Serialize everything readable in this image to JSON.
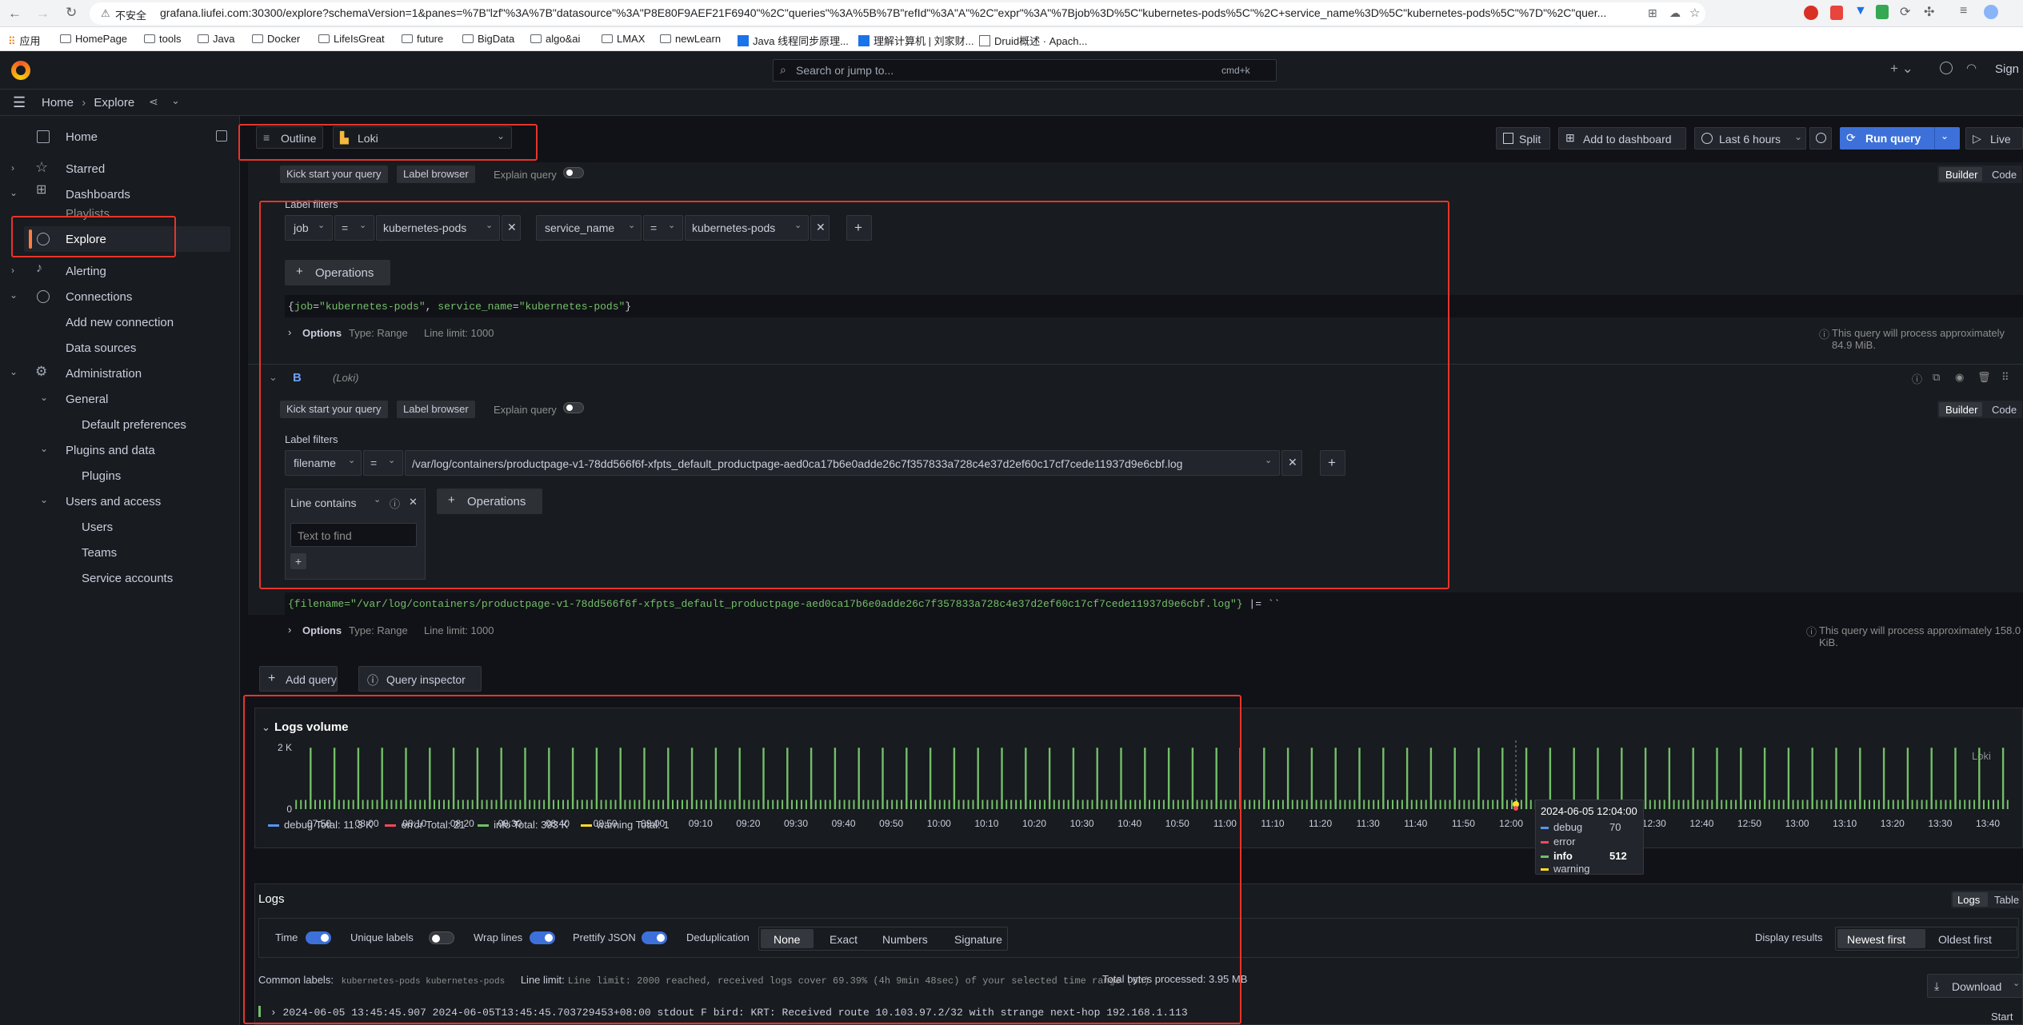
{
  "browser": {
    "insecure": "不安全",
    "url": "grafana.liufei.com:30300/explore?schemaVersion=1&panes=%7B\"lzf\"%3A%7B\"datasource\"%3A\"P8E80F9AEF21F6940\"%2C\"queries\"%3A%5B%7B\"refId\"%3A\"A\"%2C\"expr\"%3A\"%7Bjob%3D%5C\"kubernetes-pods%5C\"%2C+service_name%3D%5C\"kubernetes-pods%5C\"%7D\"%2C\"quer...",
    "bookmarks": [
      "应用",
      "HomePage",
      "tools",
      "Java",
      "Docker",
      "LifeIsGreat",
      "future",
      "BigData",
      "algo&ai",
      "LMAX",
      "newLearn",
      "Java 线程同步原理...",
      "理解计算机 | 刘家财...",
      "Druid概述 · Apach..."
    ]
  },
  "topbar": {
    "search_placeholder": "Search or jump to...",
    "shortcut": "cmd+k",
    "sign_in": "Sign"
  },
  "breadcrumb": {
    "home": "Home",
    "separator": "›",
    "current": "Explore"
  },
  "sidebar": {
    "home": "Home",
    "starred": "Starred",
    "dashboards": "Dashboards",
    "playlists": "Playlists",
    "explore": "Explore",
    "alerting": "Alerting",
    "connections": "Connections",
    "add_new_connection": "Add new connection",
    "data_sources": "Data sources",
    "administration": "Administration",
    "general": "General",
    "default_preferences": "Default preferences",
    "plugins_and_data": "Plugins and data",
    "plugins": "Plugins",
    "users_and_access": "Users and access",
    "users": "Users",
    "teams": "Teams",
    "service_accounts": "Service accounts"
  },
  "toolbar": {
    "outline": "Outline",
    "datasource": "Loki",
    "split": "Split",
    "add_to_dashboard": "Add to dashboard",
    "time_range": "Last 6 hours",
    "run_query": "Run query",
    "live": "Live"
  },
  "queryA": {
    "kick_start": "Kick start your query",
    "label_browser": "Label browser",
    "explain_query": "Explain query",
    "builder": "Builder",
    "code": "Code",
    "label_filters": "Label filters",
    "f1_label": "job",
    "f1_op": "=",
    "f1_value": "kubernetes-pods",
    "f2_label": "service_name",
    "f2_op": "=",
    "f2_value": "kubernetes-pods",
    "operations": "Operations",
    "expr_open": "{",
    "expr_k1": "job",
    "expr_eq": "=",
    "expr_v1": "\"kubernetes-pods\"",
    "expr_comma": ", ",
    "expr_k2": "service_name",
    "expr_v2": "\"kubernetes-pods\"",
    "expr_close": "}",
    "options": "Options",
    "type": "Type: Range",
    "line_limit": "Line limit: 1000",
    "process_note": "This query will process approximately 84.9 MiB."
  },
  "queryB": {
    "ref": "B",
    "datasource": "(Loki)",
    "kick_start": "Kick start your query",
    "label_browser": "Label browser",
    "explain_query": "Explain query",
    "builder": "Builder",
    "code": "Code",
    "label_filters": "Label filters",
    "f1_label": "filename",
    "f1_op": "=",
    "f1_value": "/var/log/containers/productpage-v1-78dd566f6f-xfpts_default_productpage-aed0ca17b6e0adde26c7f357833a728c4e37d2ef60c17cf7cede11937d9e6cbf.log",
    "line_contains": "Line contains",
    "text_placeholder": "Text to find",
    "operations": "Operations",
    "expr_main": "{filename=\"/var/log/containers/productpage-v1-78dd566f6f-xfpts_default_productpage-aed0ca17b6e0adde26c7f357833a728c4e37d2ef60c17cf7cede11937d9e6cbf.log\"}",
    "expr_tail": " |= ``",
    "options": "Options",
    "type": "Type: Range",
    "line_limit": "Line limit: 1000",
    "process_note": "This query will process approximately 158.0 KiB."
  },
  "actions": {
    "add_query": "Add query",
    "query_inspector": "Query inspector"
  },
  "logs_volume": {
    "title": "Logs volume",
    "source": "Loki",
    "y_ticks": [
      "2 K",
      "0"
    ],
    "x_ticks": [
      "07:50",
      "08:00",
      "08:10",
      "08:20",
      "08:30",
      "08:40",
      "08:50",
      "09:00",
      "09:10",
      "09:20",
      "09:30",
      "09:40",
      "09:50",
      "10:00",
      "10:10",
      "10:20",
      "10:30",
      "10:40",
      "10:50",
      "11:00",
      "11:10",
      "11:20",
      "11:30",
      "11:40",
      "11:50",
      "12:00",
      "12:10",
      "12:20",
      "12:30",
      "12:40",
      "12:50",
      "13:00",
      "13:10",
      "13:20",
      "13:30",
      "13:40"
    ],
    "legend": [
      {
        "name": "debug",
        "total": "Total: 11.3 K",
        "color": "#5794f2"
      },
      {
        "name": "error",
        "total": "Total: 21",
        "color": "#f2495c"
      },
      {
        "name": "info",
        "total": "Total: 393 K",
        "color": "#73bf69"
      },
      {
        "name": "warning",
        "total": "Total: 1",
        "color": "#fade2a"
      }
    ],
    "tooltip": {
      "time": "2024-06-05 12:04:00",
      "debug": "70",
      "error": "",
      "info": "512",
      "warning": ""
    }
  },
  "chart_data": {
    "type": "bar",
    "title": "Logs volume",
    "xlabel": "",
    "ylabel": "",
    "x_range": [
      "07:45",
      "13:45"
    ],
    "y_ticks": [
      0,
      2000
    ],
    "spike_interval_min": 5,
    "series": [
      {
        "name": "info",
        "spike_value": 2000,
        "baseline_value": 300,
        "total": 393000
      },
      {
        "name": "debug",
        "total": 11300
      },
      {
        "name": "error",
        "total": 21
      },
      {
        "name": "warning",
        "total": 1
      }
    ]
  },
  "logs": {
    "title": "Logs",
    "view_logs": "Logs",
    "view_table": "Table",
    "time": "Time",
    "unique_labels": "Unique labels",
    "wrap_lines": "Wrap lines",
    "prettify_json": "Prettify JSON",
    "deduplication": "Deduplication",
    "dedup_options": [
      "None",
      "Exact",
      "Numbers",
      "Signature"
    ],
    "display_results": "Display results",
    "newest_first": "Newest first",
    "oldest_first": "Oldest first",
    "common_labels": "Common labels:",
    "common_label_values": "kubernetes-pods kubernetes-pods",
    "line_limit_note": "Line limit: 2000 reached, received logs cover 69.39% (4h 9min 48sec) of your selected time range (6h)",
    "bytes_processed": "Total bytes processed: 3.95 MB",
    "download": "Download",
    "start": "Start",
    "first_line": "2024-06-05 13:45:45.907 2024-06-05T13:45:45.703729453+08:00 stdout F bird: KRT: Received route 10.103.97.2/32 with strange next-hop 192.168.1.113"
  }
}
